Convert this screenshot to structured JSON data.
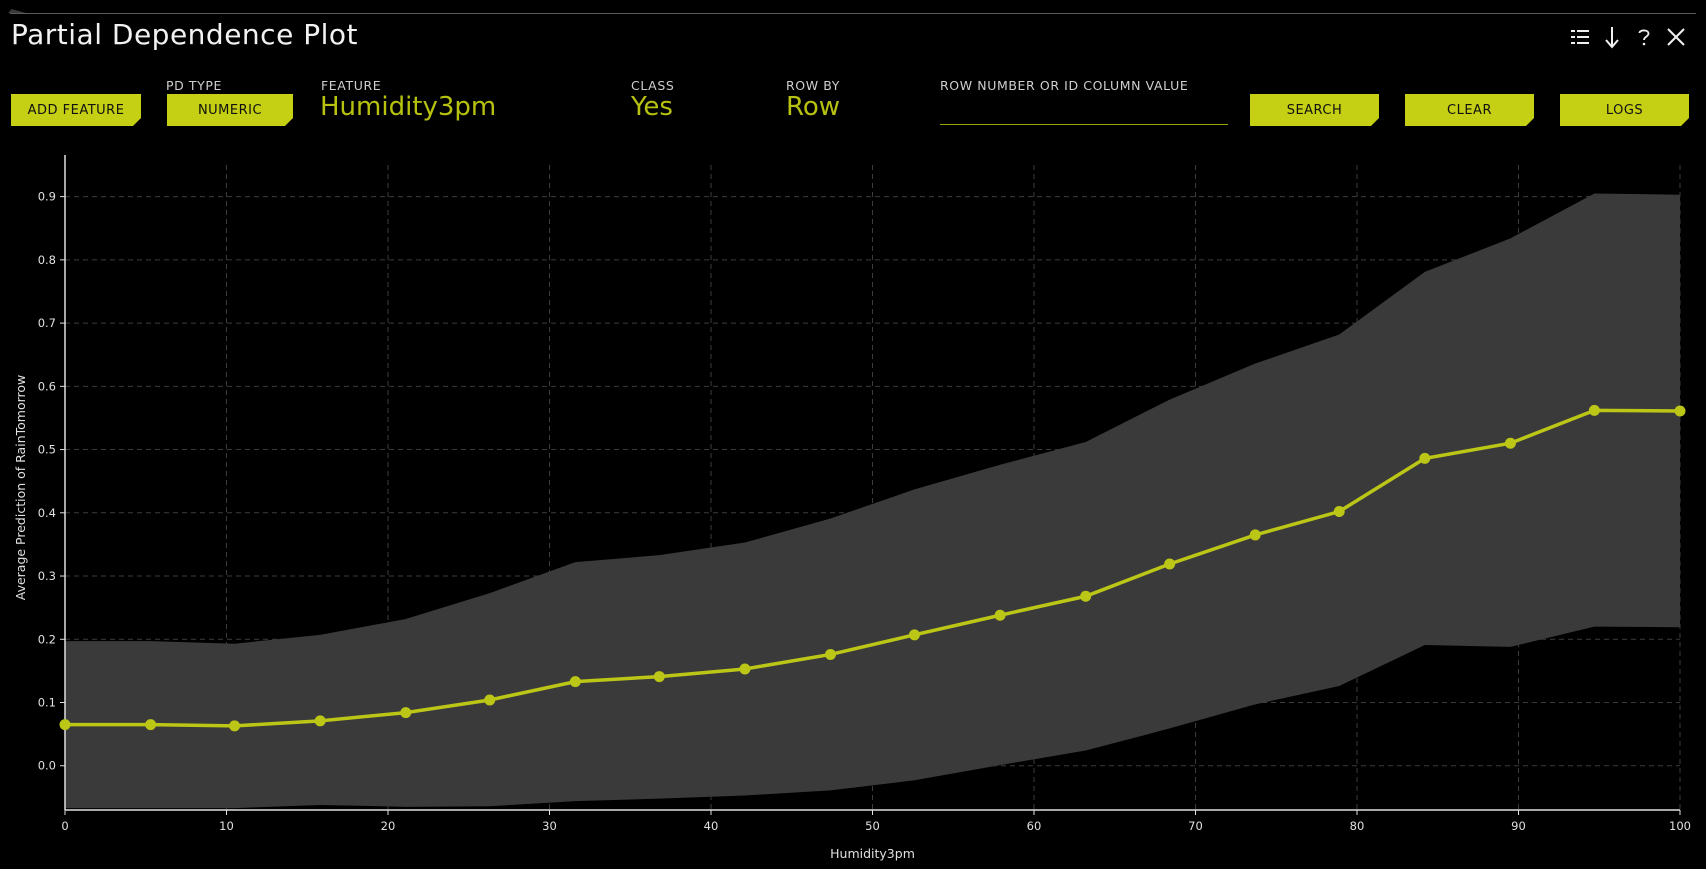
{
  "window": {
    "title": "Partial Dependence Plot",
    "controls": [
      {
        "name": "legend-list-icon"
      },
      {
        "name": "download-arrow-icon"
      },
      {
        "name": "help-question-icon"
      },
      {
        "name": "close-icon"
      }
    ]
  },
  "toolbar": {
    "add_feature_label": "ADD FEATURE",
    "pd_type_label": "PD TYPE",
    "pd_type_value": "NUMERIC",
    "feature_label": "FEATURE",
    "feature_value": "Humidity3pm",
    "class_label": "CLASS",
    "class_value": "Yes",
    "row_by_label": "ROW BY",
    "row_by_value": "Row",
    "search_field_label": "ROW NUMBER OR ID COLUMN VALUE",
    "search_field_value": "",
    "search_label": "SEARCH",
    "clear_label": "CLEAR",
    "logs_label": "LOGS"
  },
  "colors": {
    "accent": "#c5cf13",
    "line": "#bcc616",
    "band": "#3a3a3a",
    "background": "#000000",
    "grid": "#3c3c3c"
  },
  "chart_data": {
    "type": "line",
    "xlabel": "Humidity3pm",
    "ylabel": "Average Prediction of RainTomorrow",
    "xlim": [
      0,
      100
    ],
    "ylim": [
      -0.07,
      0.95
    ],
    "x_ticks": [
      0,
      10,
      20,
      30,
      40,
      50,
      60,
      70,
      80,
      90,
      100
    ],
    "y_ticks": [
      0.0,
      0.1,
      0.2,
      0.3,
      0.4,
      0.5,
      0.6,
      0.7,
      0.8,
      0.9
    ],
    "grid": true,
    "series": [
      {
        "x": [
          0,
          5.3,
          10.5,
          15.8,
          21.1,
          26.3,
          31.6,
          36.8,
          42.1,
          47.4,
          52.6,
          57.9,
          63.2,
          68.4,
          73.7,
          78.9,
          84.2,
          89.5,
          94.7,
          100
        ],
        "mean": [
          0.065,
          0.065,
          0.063,
          0.071,
          0.084,
          0.104,
          0.133,
          0.141,
          0.153,
          0.176,
          0.207,
          0.238,
          0.268,
          0.319,
          0.365,
          0.402,
          0.486,
          0.51,
          0.562,
          0.561
        ],
        "upper": [
          0.197,
          0.197,
          0.193,
          0.207,
          0.232,
          0.273,
          0.322,
          0.333,
          0.353,
          0.391,
          0.437,
          0.476,
          0.512,
          0.579,
          0.636,
          0.682,
          0.781,
          0.834,
          0.905,
          0.903
        ],
        "lower": [
          -0.067,
          -0.067,
          -0.067,
          -0.062,
          -0.065,
          -0.064,
          -0.056,
          -0.052,
          -0.047,
          -0.039,
          -0.023,
          0.001,
          0.024,
          0.059,
          0.097,
          0.126,
          0.191,
          0.188,
          0.22,
          0.219
        ]
      }
    ]
  }
}
